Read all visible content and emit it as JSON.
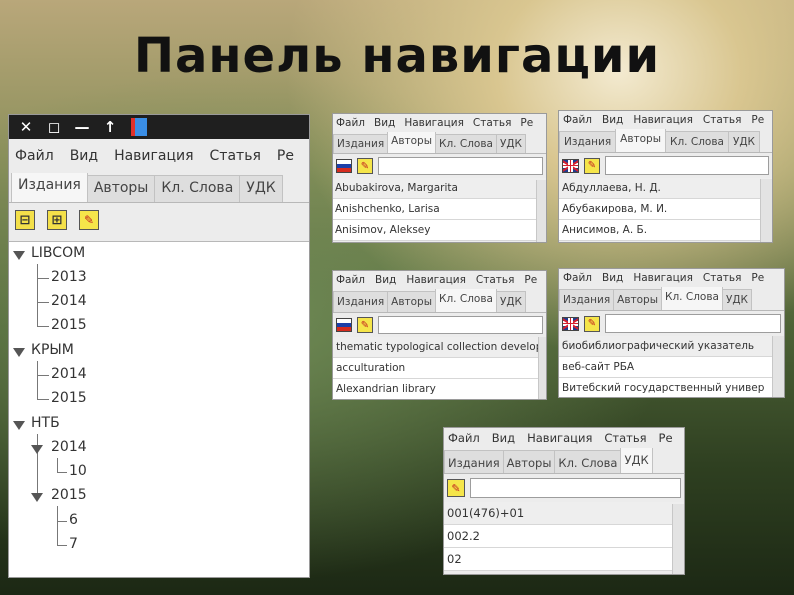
{
  "slide": {
    "title": "Панель навигации"
  },
  "menu": [
    "Файл",
    "Вид",
    "Навигация",
    "Статья",
    "Ре"
  ],
  "tabs": [
    "Издания",
    "Авторы",
    "Кл. Слова",
    "УДК"
  ],
  "main_window": {
    "titlebar_icons": [
      "close-icon",
      "maximize-icon",
      "minimize-icon",
      "up-arrow-icon",
      "color-swatch-icon"
    ],
    "toolbar_icons": [
      "collapse-all-icon",
      "expand-all-icon",
      "edit-pencil-icon"
    ],
    "tree": [
      {
        "label": "LIBCOM",
        "children": [
          "2013",
          "2014",
          "2015"
        ]
      },
      {
        "label": "КРЫМ",
        "children": [
          "2014",
          "2015"
        ]
      },
      {
        "label": "НТБ",
        "children": [
          {
            "label": "2014",
            "children": [
              "10"
            ]
          },
          {
            "label": "2015",
            "children": [
              "6",
              "7"
            ]
          }
        ]
      }
    ]
  },
  "panels": {
    "authors_ru": {
      "active_tab": "Авторы",
      "flag": "ru-flag-icon",
      "rows": [
        "Abubakirova, Margarita",
        "Anishchenko, Larisa",
        "Anisimov, Aleksey"
      ]
    },
    "authors_en": {
      "active_tab": "Авторы",
      "flag": "uk-flag-icon",
      "rows": [
        "Абдуллаева, Н. Д.",
        "Абубакирова, М. И.",
        "Анисимов, А. Б."
      ]
    },
    "keywords_ru": {
      "active_tab": "Кл. Слова",
      "flag": "ru-flag-icon",
      "rows": [
        "thematic typological collection develop",
        "acculturation",
        "Alexandrian library"
      ]
    },
    "keywords_en": {
      "active_tab": "Кл. Слова",
      "flag": "uk-flag-icon",
      "rows": [
        "биобиблиографический указатель",
        "веб-сайт РБА",
        "Витебский государственный универ"
      ]
    },
    "udk": {
      "active_tab": "УДК",
      "rows": [
        "001(476)+01",
        "002.2",
        "02"
      ]
    }
  }
}
